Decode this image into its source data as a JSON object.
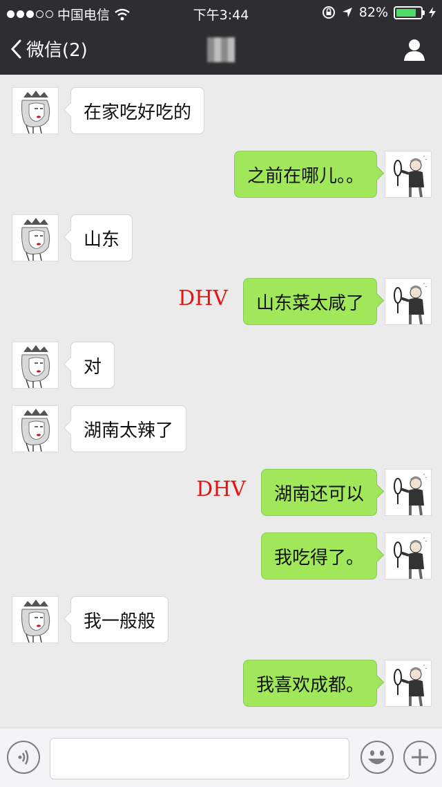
{
  "status_bar": {
    "carrier": "中国电信",
    "time": "下午3:44",
    "battery_percent": "82%",
    "battery_level": 0.82,
    "battery_color": "#4cd964"
  },
  "nav": {
    "back_label": "微信(2)",
    "back_icon": "chevron-left-icon",
    "profile_icon": "person-icon"
  },
  "messages": [
    {
      "side": "in",
      "text": "在家吃好吃的"
    },
    {
      "side": "out",
      "text": "之前在哪儿。。"
    },
    {
      "side": "in",
      "text": "山东"
    },
    {
      "side": "out",
      "text": "山东菜太咸了",
      "annotation": "DHV"
    },
    {
      "side": "in",
      "text": "对"
    },
    {
      "side": "in",
      "text": "湖南太辣了"
    },
    {
      "side": "out",
      "text": "湖南还可以",
      "annotation": "DHV"
    },
    {
      "side": "out",
      "text": "我吃得了。"
    },
    {
      "side": "in",
      "text": "我一般般"
    },
    {
      "side": "out",
      "text": "我喜欢成都。"
    }
  ],
  "input_bar": {
    "voice_icon": "voice-icon",
    "emoji_icon": "emoji-icon",
    "plus_icon": "plus-icon",
    "input_value": ""
  },
  "colors": {
    "header_bg": "#2e2e32",
    "chat_bg": "#ebebeb",
    "outgoing_bubble": "#a0e75a",
    "incoming_bubble": "#ffffff",
    "annotation": "#e8130f"
  }
}
